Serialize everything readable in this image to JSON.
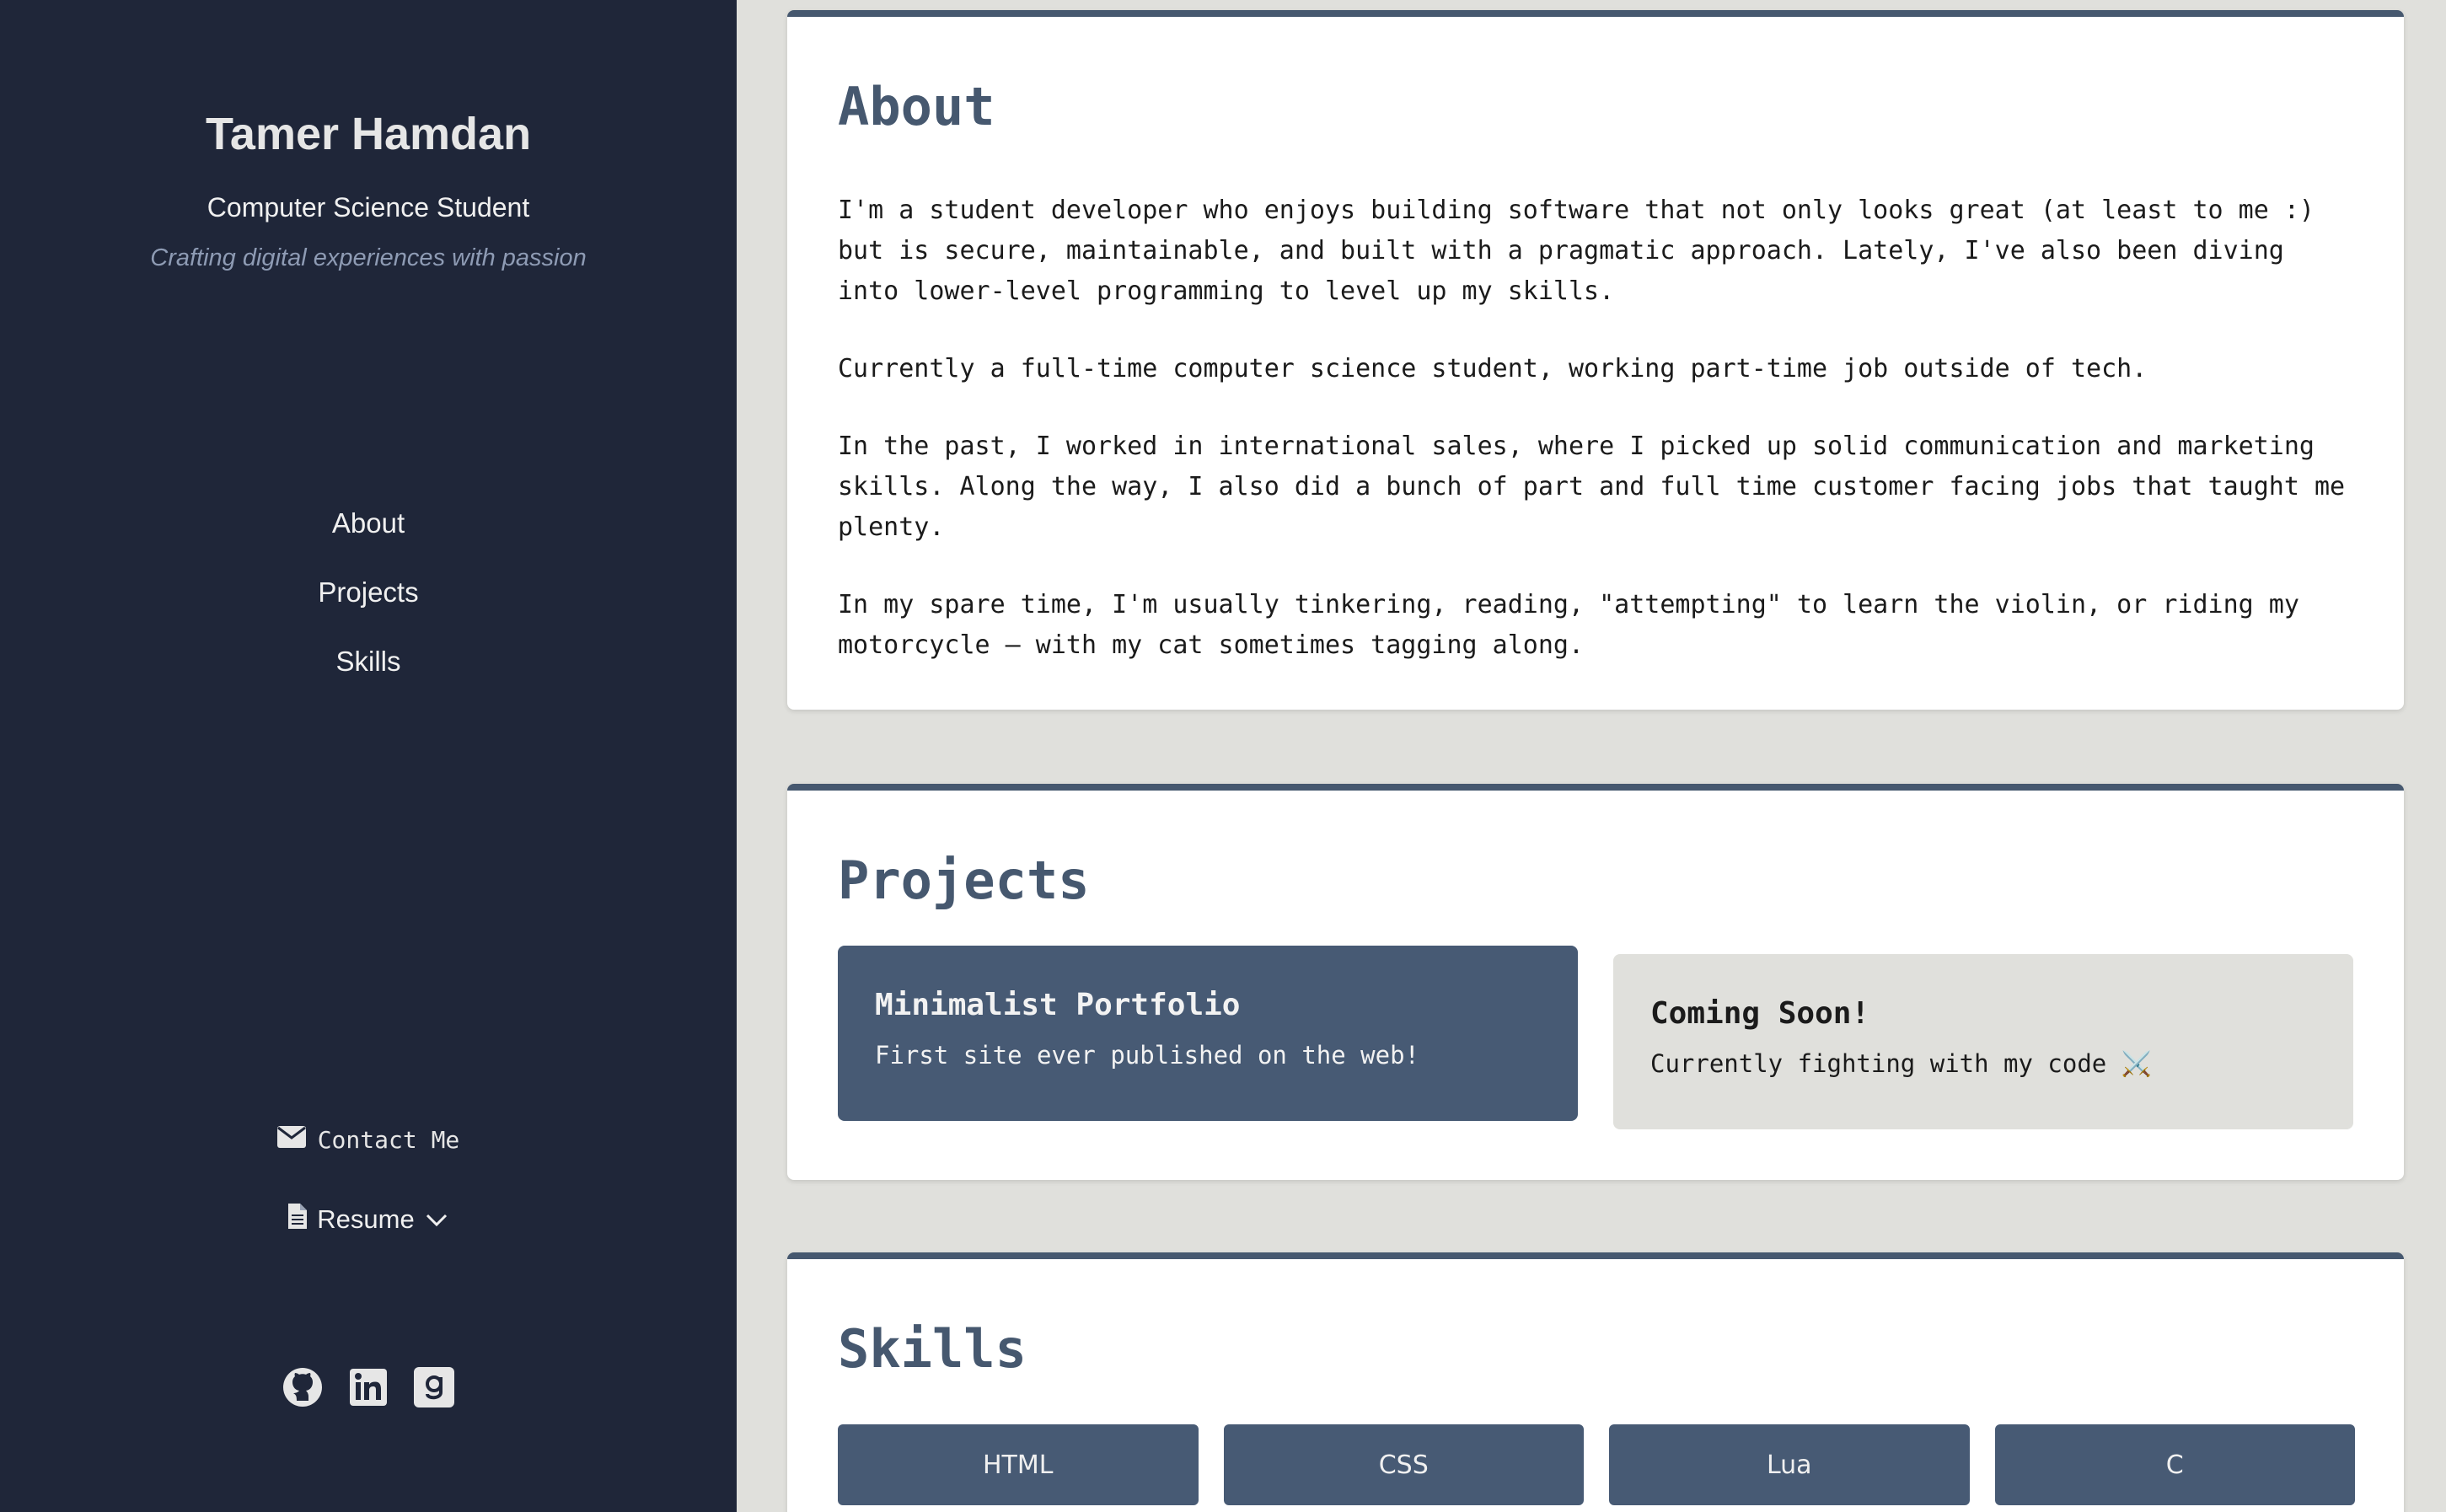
{
  "profile": {
    "name": "Tamer Hamdan",
    "role": "Computer Science Student",
    "tagline": "Crafting digital experiences with passion"
  },
  "nav": {
    "items": [
      {
        "label": "About"
      },
      {
        "label": "Projects"
      },
      {
        "label": "Skills"
      }
    ]
  },
  "contact": {
    "label": "Contact Me",
    "icon": "envelope-icon"
  },
  "resume": {
    "label": "Resume",
    "icon": "document-icon"
  },
  "social": [
    "github-icon",
    "linkedin-icon",
    "goodreads-icon"
  ],
  "about": {
    "title": "About",
    "paragraphs": [
      "I'm a student developer who enjoys building software that not only looks great (at least to me :) but is secure, maintainable, and built with a pragmatic approach. Lately, I've also been diving into lower-level programming to level up my skills.",
      "Currently a full-time computer science student, working part-time job outside of tech.",
      "In the past, I worked in international sales, where I picked up solid communication and marketing skills. Along the way, I also did a bunch of part and full time customer facing jobs that taught me plenty.",
      "In my spare time, I'm usually tinkering, reading, \"attempting\" to learn the violin, or riding my motorcycle — with my cat sometimes tagging along."
    ]
  },
  "projects": {
    "title": "Projects",
    "items": [
      {
        "title": "Minimalist Portfolio",
        "description": "First site ever published on the web!"
      },
      {
        "title": "Coming Soon!",
        "description": "Currently fighting with my code ⚔️"
      }
    ]
  },
  "skills": {
    "title": "Skills",
    "items": [
      {
        "label": "HTML"
      },
      {
        "label": "CSS"
      },
      {
        "label": "Lua"
      },
      {
        "label": "C"
      }
    ]
  },
  "colors": {
    "sidebar": "#1f2639",
    "accent": "#46586f",
    "background": "#e0e0dc"
  }
}
